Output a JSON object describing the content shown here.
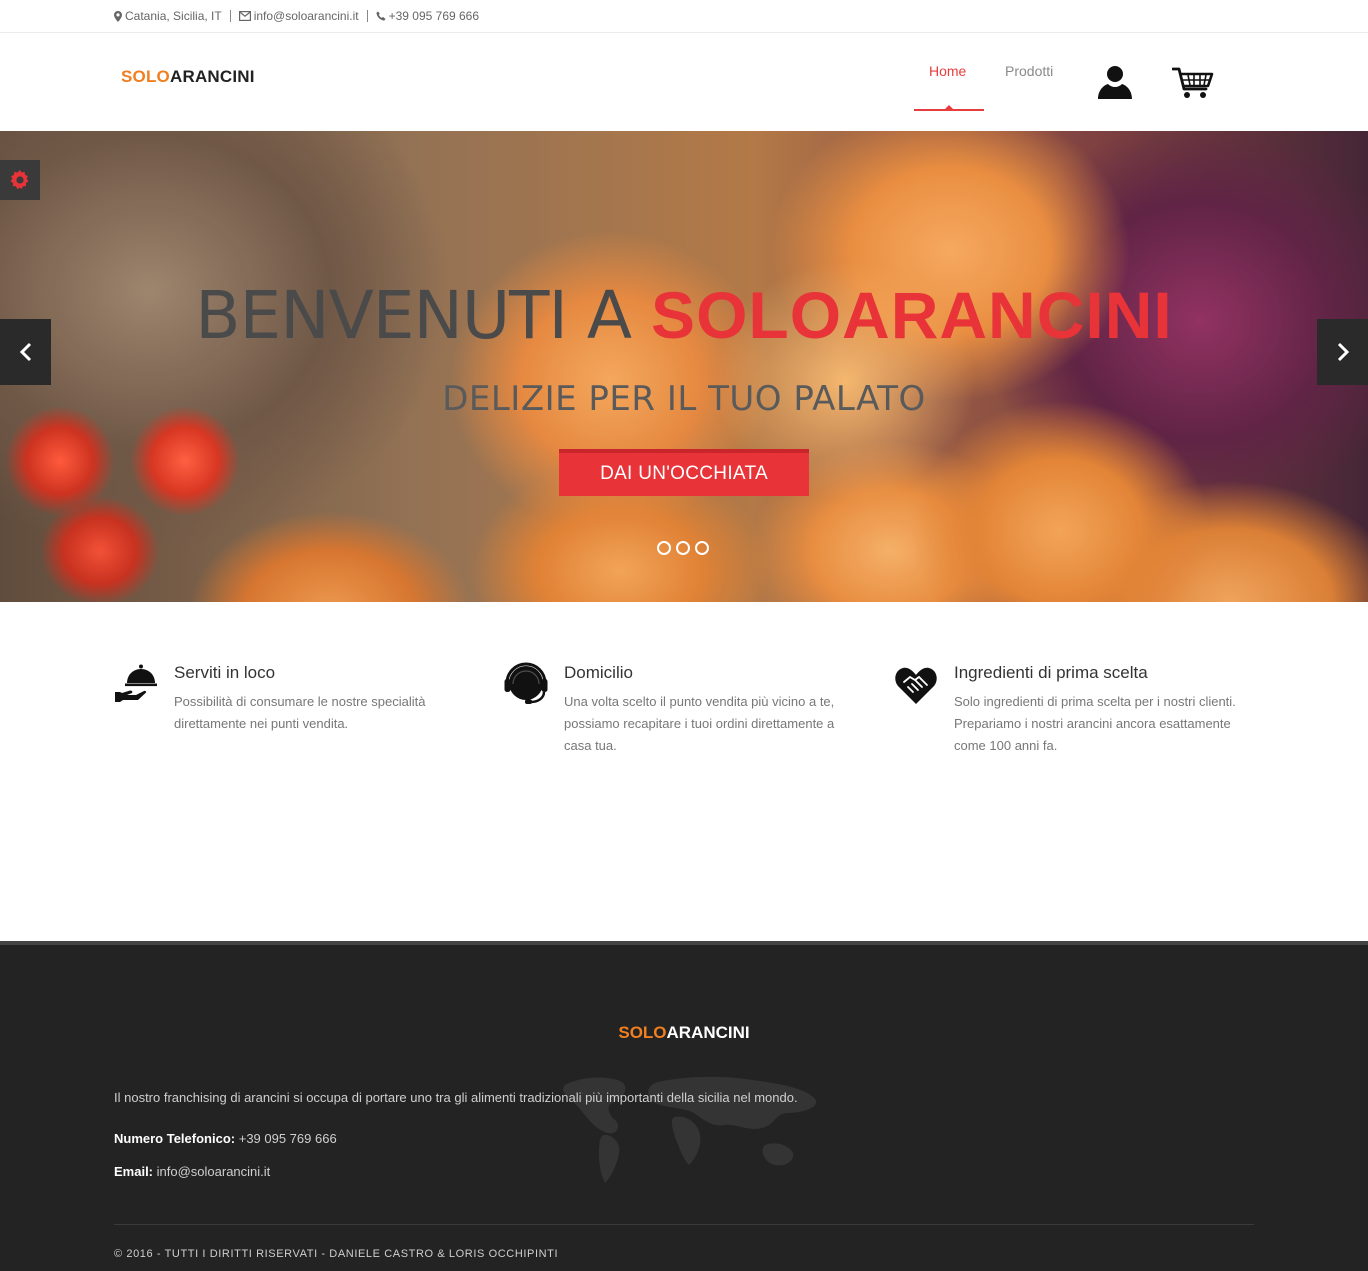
{
  "topbar": {
    "location": "Catania, Sicilia, IT",
    "email": "info@soloarancini.it",
    "phone": "+39 095 769 666"
  },
  "header": {
    "logo_solo": "SOLO",
    "logo_rest": "ARANCINI",
    "nav": [
      {
        "label": "Home",
        "active": true
      },
      {
        "label": "Prodotti",
        "active": false
      }
    ],
    "icons": [
      "user-icon",
      "cart-icon"
    ]
  },
  "hero": {
    "title_part1": "BENVENUTI A ",
    "title_part2": "SOLOARANCINI",
    "subtitle": "DELIZIE PER IL TUO PALATO",
    "button": "DAI UN'OCCHIATA",
    "slides": 3,
    "accent": "#e83339"
  },
  "features": [
    {
      "icon": "serving-tray-icon",
      "title": "Serviti in loco",
      "desc": "Possibilità di consumare le nostre specialità direttamente nei punti vendita."
    },
    {
      "icon": "headset-icon",
      "title": "Domicilio",
      "desc": "Una volta scelto il punto vendita più vicino a te, possiamo recapitare i tuoi ordini direttamente a casa tua."
    },
    {
      "icon": "handshake-heart-icon",
      "title": "Ingredienti di prima scelta",
      "desc": "Solo ingredienti di prima scelta per i nostri clienti. Prepariamo i nostri arancini ancora esattamente come 100 anni fa."
    }
  ],
  "footer": {
    "logo_solo": "SOLO",
    "logo_rest": "ARANCINI",
    "description": "Il nostro franchising di arancini si occupa di portare uno tra gli alimenti tradizionali più importanti della sicilia nel mondo.",
    "phone_label": "Numero Telefonico:",
    "phone_value": " +39 095 769 666",
    "email_label": "Email:",
    "email_value": " info@soloarancini.it",
    "copyright": "© 2016 - TUTTI I DIRITTI RISERVATI - DANIELE CASTRO & LORIS OCCHIPINTI"
  },
  "colors": {
    "brand_orange": "#f07f1f",
    "brand_red": "#e83339",
    "footer_bg": "#232323"
  }
}
